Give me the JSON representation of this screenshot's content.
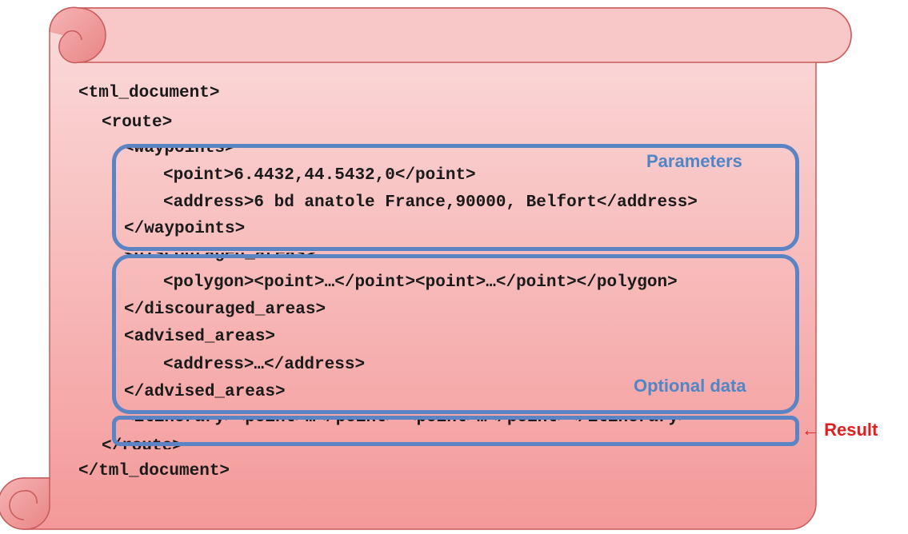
{
  "code_lines": [
    "<tml_document>",
    "<route>",
    "<waypoints>",
    "<point>6.4432,44.5432,0</point>",
    "<address>6 bd anatole France,90000, Belfort</address>",
    "</waypoints>",
    "<discouraged_areas>",
    "<polygon><point>…</point><point>…</point></polygon>",
    "</discouraged_areas>",
    "<advised_areas>",
    "<address>…</address>",
    "</advised_areas>",
    "<itinerary><point>…</point> <point>…</point></itinerary>",
    "</route>",
    "</tml_document>"
  ],
  "groups": {
    "parameters_label": "Parameters",
    "optional_label": "Optional data",
    "result_label": "← Result"
  },
  "colors": {
    "scroll_fill_top": "#fbd6d6",
    "scroll_fill_bottom": "#f59a9a",
    "scroll_stroke": "#c95a5a",
    "group_border": "#5b84c4",
    "group_label": "#4f86c6",
    "result_label": "#e02020"
  }
}
